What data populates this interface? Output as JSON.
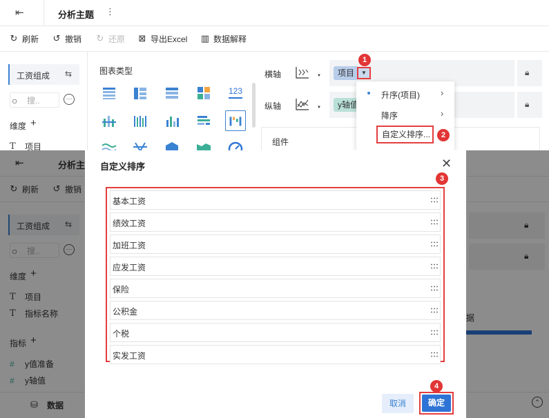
{
  "header": {
    "title": "分析主题"
  },
  "toolbar": {
    "refresh": "刷新",
    "undo": "撤销",
    "redo": "还原",
    "export": "导出Excel",
    "explain": "数据解释"
  },
  "sidebar": {
    "dataset": "工资组成",
    "search_placeholder": "搜..",
    "dimension_label": "维度",
    "dimension_fields": [
      "项目",
      "指标名称"
    ],
    "measure_label": "指标",
    "measure_fields": [
      "y值准备",
      "y轴值"
    ],
    "data_tab": "数据"
  },
  "chart_types": {
    "header": "图表类型",
    "number_icon": "123"
  },
  "axes": {
    "x_label": "横轴",
    "x_field": "项目",
    "y_label": "纵轴",
    "y_field": "y轴值",
    "component": "组件"
  },
  "sort_menu": {
    "items": [
      "升序(项目)",
      "降序",
      "自定义排序..."
    ]
  },
  "background_partial": {
    "text": "据"
  },
  "dialog": {
    "title": "自定义排序",
    "items": [
      "基本工资",
      "绩效工资",
      "加班工资",
      "应发工资",
      "保险",
      "公积金",
      "个税",
      "实发工资"
    ],
    "cancel": "取消",
    "ok": "确定"
  },
  "badges": [
    "1",
    "2",
    "3",
    "4"
  ],
  "colors": {
    "accent": "#2e74d6",
    "highlight_border": "#e43d3d",
    "measure_icon": "#3cae96",
    "pill_x": "#b8cdea",
    "pill_y": "#b8e0d6"
  }
}
